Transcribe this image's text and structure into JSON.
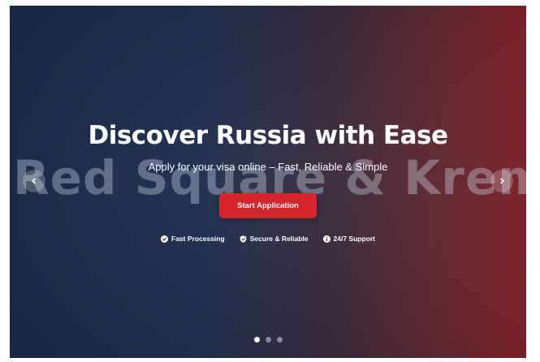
{
  "hero": {
    "watermark": "Red Square & Kremlin",
    "title": "Discover Russia with Ease",
    "subtitle": "Apply for your visa online – Fast, Reliable & Simple",
    "cta_label": "Start Application",
    "features": [
      {
        "icon": "check-circle-icon",
        "label": "Fast Processing"
      },
      {
        "icon": "shield-check-icon",
        "label": "Secure & Reliable"
      },
      {
        "icon": "info-circle-icon",
        "label": "24/7 Support"
      }
    ],
    "prev_icon": "chevron-left-icon",
    "next_icon": "chevron-right-icon",
    "slide_count": 3,
    "active_slide": 1
  },
  "colors": {
    "cta": "#d6262c",
    "gradient_left": "#1a2c4c",
    "gradient_right": "#8a252a"
  }
}
